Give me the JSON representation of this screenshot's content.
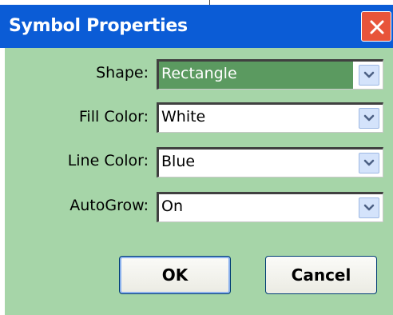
{
  "dialog": {
    "title": "Symbol Properties",
    "close_icon": "close-icon"
  },
  "fields": [
    {
      "label": "Shape:",
      "value": "Rectangle",
      "selected": true
    },
    {
      "label": "Fill Color:",
      "value": "White",
      "selected": false
    },
    {
      "label": "Line Color:",
      "value": "Blue",
      "selected": false
    },
    {
      "label": "AutoGrow:",
      "value": "On",
      "selected": false
    }
  ],
  "buttons": {
    "ok_label": "OK",
    "cancel_label": "Cancel"
  },
  "colors": {
    "titlebar": "#0b5cd6",
    "body": "#a6d5a8",
    "selection": "#5b9a60",
    "close": "#e8543a"
  }
}
